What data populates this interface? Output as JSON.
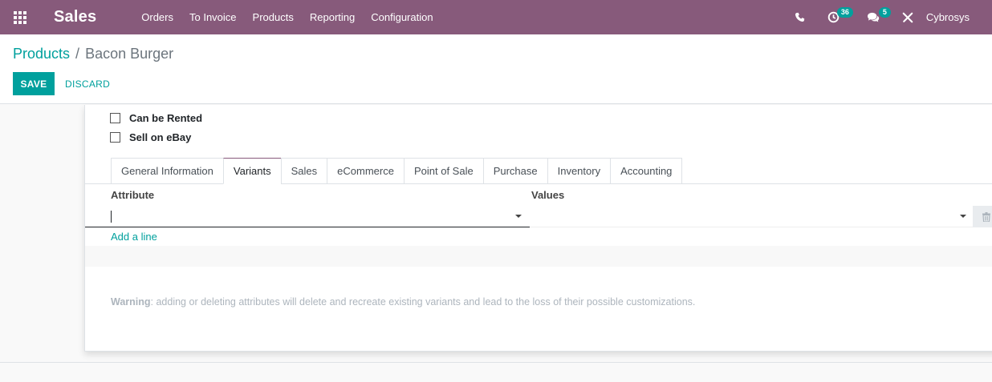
{
  "navbar": {
    "app_name": "Sales",
    "menu": [
      "Orders",
      "To Invoice",
      "Products",
      "Reporting",
      "Configuration"
    ],
    "activity_count": "36",
    "message_count": "5",
    "user": "Cybrosys"
  },
  "breadcrumb": {
    "parent": "Products",
    "separator": "/",
    "current": "Bacon Burger"
  },
  "buttons": {
    "save": "SAVE",
    "discard": "DISCARD"
  },
  "options": {
    "can_be_rented": "Can be Rented",
    "sell_on_ebay": "Sell on eBay"
  },
  "tabs": [
    "General Information",
    "Variants",
    "Sales",
    "eCommerce",
    "Point of Sale",
    "Purchase",
    "Inventory",
    "Accounting"
  ],
  "active_tab": "Variants",
  "variants": {
    "col_attribute": "Attribute",
    "col_values": "Values",
    "add_line": "Add a line",
    "warning_label": "Warning",
    "warning_text": ": adding or deleting attributes will delete and recreate existing variants and lead to the loss of their possible customizations."
  },
  "colors": {
    "brand": "#875a7b",
    "accent": "#00a09d"
  }
}
